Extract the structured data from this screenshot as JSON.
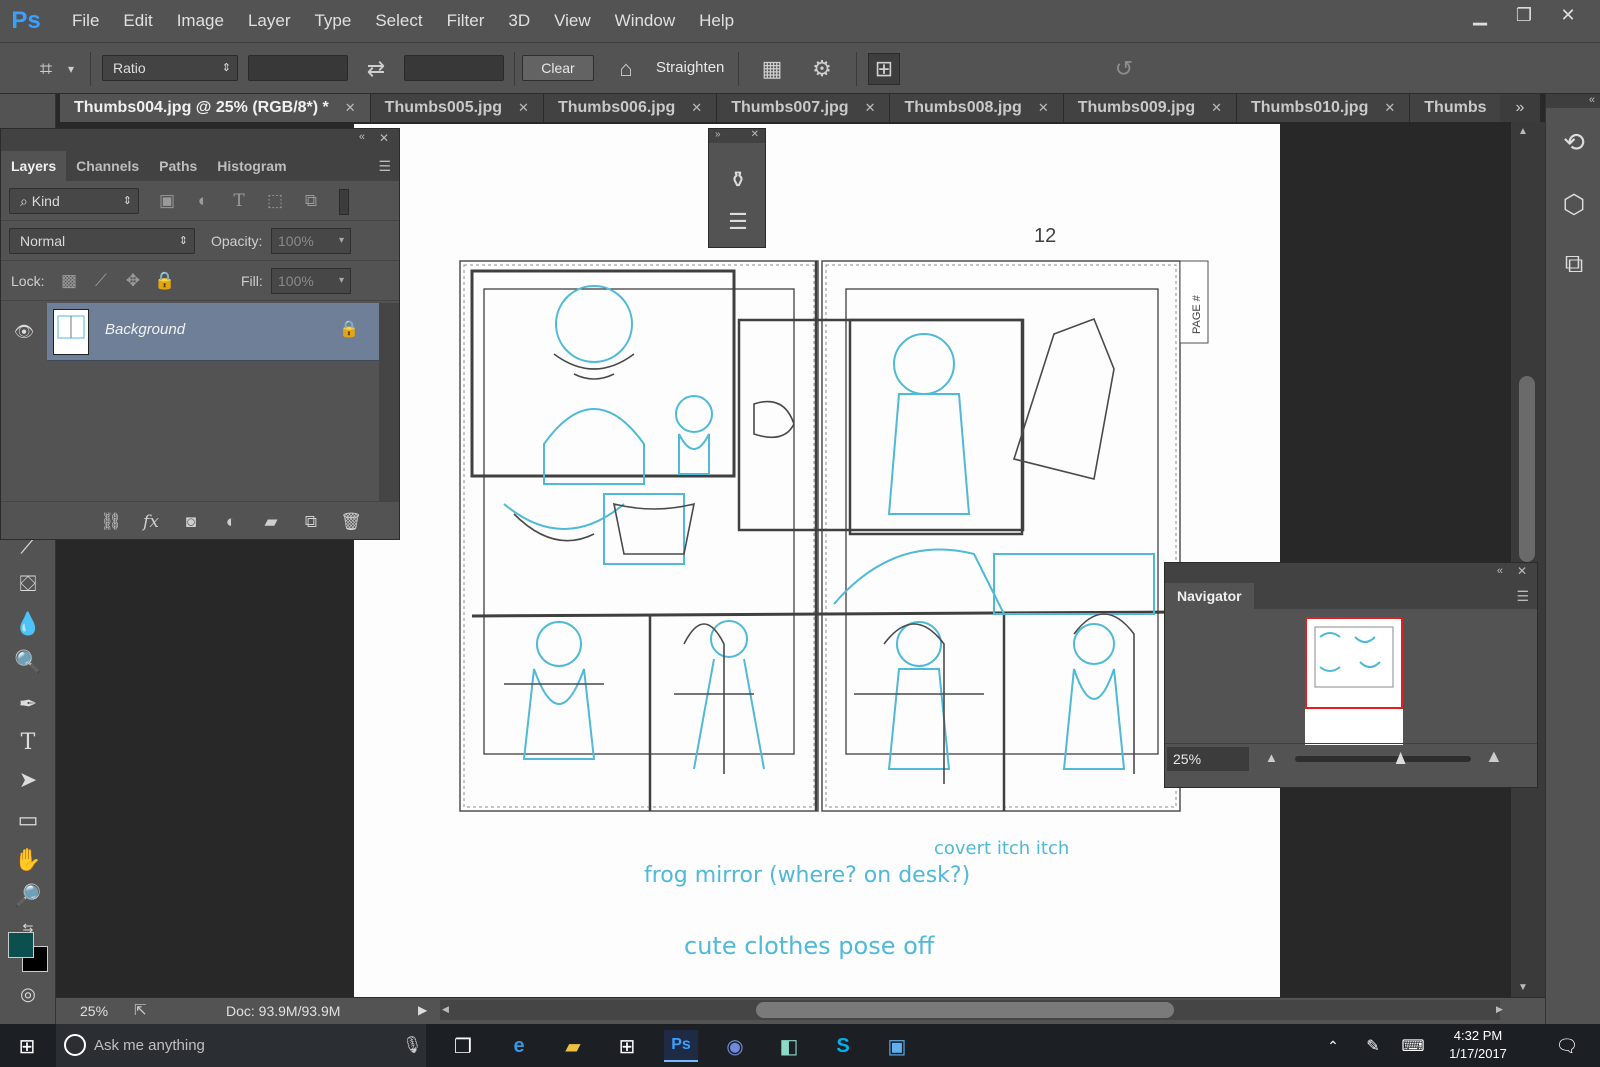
{
  "app": {
    "logo": "Ps"
  },
  "menu": [
    "File",
    "Edit",
    "Image",
    "Layer",
    "Type",
    "Select",
    "Filter",
    "3D",
    "View",
    "Window",
    "Help"
  ],
  "window_controls": {
    "minimize": "▁",
    "restore": "❐",
    "close": "✕"
  },
  "options_bar": {
    "ratio_label": "Ratio",
    "clear_label": "Clear",
    "straighten_label": "Straighten",
    "width_value": "",
    "height_value": ""
  },
  "tabs": [
    {
      "label": "Thumbs004.jpg @ 25% (RGB/8*) *",
      "active": true
    },
    {
      "label": "Thumbs005.jpg",
      "active": false
    },
    {
      "label": "Thumbs006.jpg",
      "active": false
    },
    {
      "label": "Thumbs007.jpg",
      "active": false
    },
    {
      "label": "Thumbs008.jpg",
      "active": false
    },
    {
      "label": "Thumbs009.jpg",
      "active": false
    },
    {
      "label": "Thumbs010.jpg",
      "active": false
    },
    {
      "label": "Thumbs",
      "active": false
    }
  ],
  "tab_close": "✕",
  "tab_overflow": "»",
  "layers_panel": {
    "tabs": [
      "Layers",
      "Channels",
      "Paths",
      "Histogram"
    ],
    "kind_label": "Kind",
    "blend_mode": "Normal",
    "opacity_label": "Opacity:",
    "opacity_value": "100%",
    "lock_label": "Lock:",
    "fill_label": "Fill:",
    "fill_value": "100%",
    "layer_name": "Background"
  },
  "navigator": {
    "title": "Navigator",
    "zoom": "25%",
    "zoom_fraction": 0.25
  },
  "status": {
    "zoom": "25%",
    "doc": "Doc: 93.9M/93.9M"
  },
  "canvas_notes": {
    "page_number": "12",
    "page_tag": "PAGE #",
    "note1": "frog mirror (where? on desk?)",
    "note2": "covert itch itch",
    "note3": "cute clothes pose off"
  },
  "taskbar": {
    "search_placeholder": "Ask me anything",
    "time": "4:32 PM",
    "date": "1/17/2017"
  },
  "colors": {
    "foreground": "#0b4f4f",
    "background": "#000000",
    "sketch_blue": "#4fb9d8",
    "sketch_gray": "#505050",
    "accent_blue": "#3aa0ff"
  }
}
